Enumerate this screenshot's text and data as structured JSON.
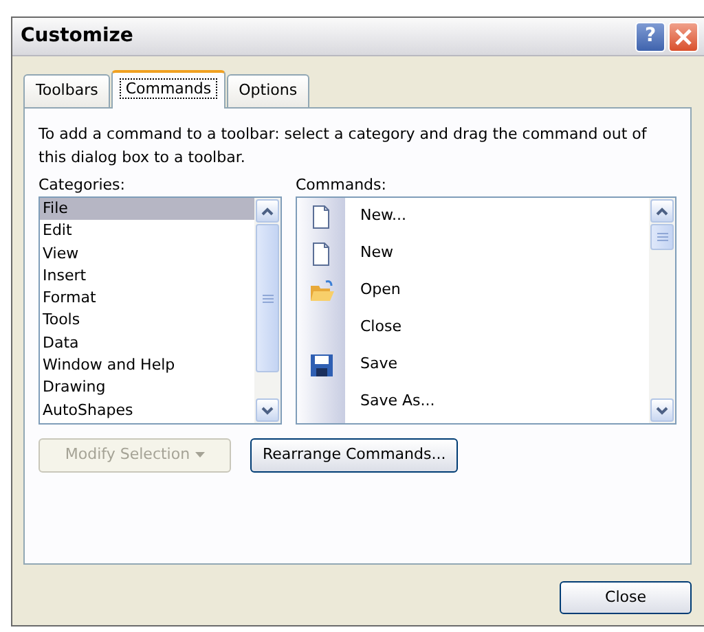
{
  "window": {
    "title": "Customize",
    "buttons": [
      "?"
    ]
  },
  "tabs": [
    {
      "label": "Toolbars",
      "selected": false
    },
    {
      "label": "Commands",
      "selected": true
    },
    {
      "label": "Options",
      "selected": false
    }
  ],
  "instructions": "To add a command to a toolbar: select a category and drag the command out of this dialog box to a toolbar.",
  "categories": {
    "label": "Categories:",
    "items": [
      {
        "label": "File",
        "selected": true
      },
      {
        "label": "Edit",
        "selected": false
      },
      {
        "label": "View",
        "selected": false
      },
      {
        "label": "Insert",
        "selected": false
      },
      {
        "label": "Format",
        "selected": false
      },
      {
        "label": "Tools",
        "selected": false
      },
      {
        "label": "Data",
        "selected": false
      },
      {
        "label": "Window and Help",
        "selected": false
      },
      {
        "label": "Drawing",
        "selected": false
      },
      {
        "label": "AutoShapes",
        "selected": false
      }
    ]
  },
  "commands": {
    "label": "Commands:",
    "items": [
      {
        "label": "New...",
        "kind": "document"
      },
      {
        "label": "New",
        "kind": "document"
      },
      {
        "label": "Open",
        "kind": "folder"
      },
      {
        "label": "Close",
        "kind": "plain"
      },
      {
        "label": "Save",
        "kind": "floppy"
      },
      {
        "label": "Save As...",
        "kind": "plain"
      }
    ]
  },
  "actions": [
    {
      "label": "Modify Selection",
      "disabled": true,
      "dropdown": true
    },
    {
      "label": "Rearrange Commands...",
      "disabled": false,
      "dropdown": false
    }
  ],
  "footer": {
    "close": "Close"
  }
}
